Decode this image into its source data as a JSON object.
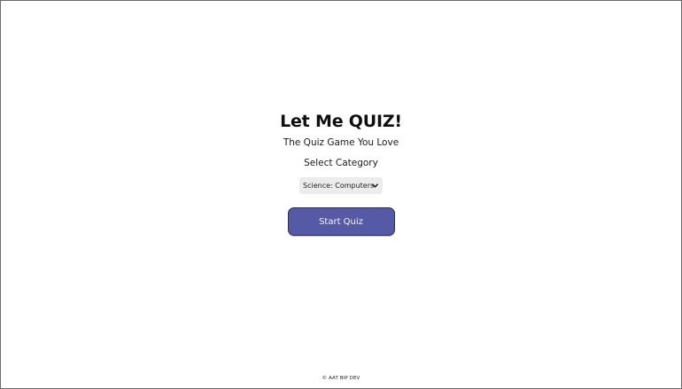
{
  "app": {
    "title": "Let Me QUIZ!",
    "subtitle": "The Quiz Game You Love"
  },
  "category": {
    "label": "Select Category",
    "selected": "Science: Computers",
    "icon": "chevron-down-icon"
  },
  "actions": {
    "start_label": "Start Quiz"
  },
  "footer": {
    "text": "© AAT BIP DEV"
  },
  "colors": {
    "button_fill": "#565aa6",
    "button_border": "#2c2e57",
    "select_bg": "#ececec"
  }
}
